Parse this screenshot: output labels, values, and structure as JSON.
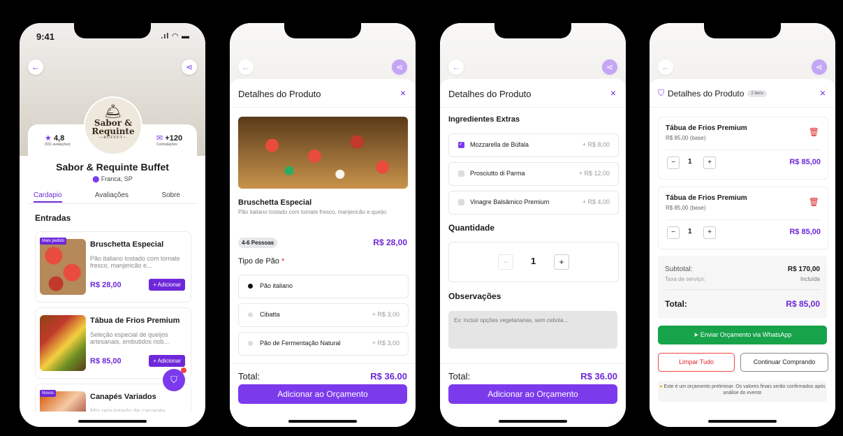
{
  "status": {
    "time": "9:41",
    "icons": "..ıl ᯤ ▬"
  },
  "screen1": {
    "logo": {
      "line1": "Sabor &",
      "line2": "Requinte",
      "line3": "—BUFFET—"
    },
    "rating": {
      "value": "4,8",
      "count": "(531 avaliações)"
    },
    "contracts": {
      "value": "+120",
      "label": "Contratações"
    },
    "name": "Sabor & Requinte Buffet",
    "city": "Franca, SP",
    "tabs": [
      "Cardapio",
      "Avaliações",
      "Sobre"
    ],
    "section": "Entradas",
    "items": [
      {
        "badge": "Mais pedido",
        "name": "Bruschetta Especial",
        "desc": "Pão italiano tostado com tomate fresco, manjericão e...",
        "price": "R$ 28,00",
        "add": "+ Adicionar"
      },
      {
        "badge": "",
        "name": "Tábua de Frios Premium",
        "desc": "Seleção especial de queijos artesanais, embutidos nob...",
        "price": "R$ 85,00",
        "add": "+ Adicionar"
      },
      {
        "badge": "Novos",
        "name": "Canapés Variados",
        "desc": "Mix requintado de canapés",
        "price": "",
        "add": ""
      }
    ]
  },
  "screen2": {
    "title": "Detalhes do Produto",
    "close": "×",
    "product_name": "Bruschetta Especial",
    "product_desc": "Pão italiano tostado com tomate fresco, manjericão e queijo",
    "serves": "4-6 Pessoas",
    "price": "R$ 28,00",
    "bread_heading": "Tipo de Pão",
    "required": "*",
    "breads": [
      {
        "label": "Pão italiano",
        "extra": "",
        "selected": true
      },
      {
        "label": "Cibatta",
        "extra": "+ R$ 3,00",
        "selected": false
      },
      {
        "label": "Pão de Fermentação Natural",
        "extra": "+ R$ 3,00",
        "selected": false
      }
    ],
    "total_label": "Total:",
    "total_value": "R$ 36.00",
    "cta": "Adicionar ao Orçamento"
  },
  "screen3": {
    "title": "Detalhes do Produto",
    "close": "×",
    "extras_heading": "Ingredientes Extras",
    "extras": [
      {
        "label": "Mozzarella de Búfala",
        "extra": "+ R$ 8,00",
        "checked": true
      },
      {
        "label": "Prosciutto di Parma",
        "extra": "+ R$ 12,00",
        "checked": false
      },
      {
        "label": "Vinagre Balsâmico Premium",
        "extra": "+ R$ 4,00",
        "checked": false
      }
    ],
    "qty_heading": "Quantidade",
    "qty_minus": "−",
    "qty": "1",
    "qty_plus": "+",
    "obs_heading": "Observações",
    "obs_placeholder": "Ex: Incluir opções vegetarianas, sem cebola...",
    "total_label": "Total:",
    "total_value": "R$ 36.00",
    "cta": "Adicionar ao Orçamento"
  },
  "screen4": {
    "title": "Detalhes do Produto",
    "count_badge": "2 itens",
    "close": "×",
    "cart": [
      {
        "name": "Tábua de Frios Premium",
        "base": "R$ 85,00 (base)",
        "qty": "1",
        "price": "R$ 85,00"
      },
      {
        "name": "Tábua de Frios Premium",
        "base": "R$ 85,00 (base)",
        "qty": "1",
        "price": "R$ 85,00"
      }
    ],
    "subtotal_label": "Subtotal:",
    "subtotal_value": "R$ 170,00",
    "fee_label": "Taxa de serviço:",
    "fee_value": "Incluída",
    "total_label": "Total:",
    "total_value": "R$ 85,00",
    "whatsapp": "Enviar Orçamento via WhatsApp",
    "clear": "Limpar Tudo",
    "continue": "Continuar Comprando",
    "note": "Este é um orçamento preliminar. Os valores finais serão confirmados após análise do evento"
  },
  "colors": {
    "accent": "#7c3aed",
    "whatsapp": "#16a34a",
    "danger": "#dc2626"
  }
}
